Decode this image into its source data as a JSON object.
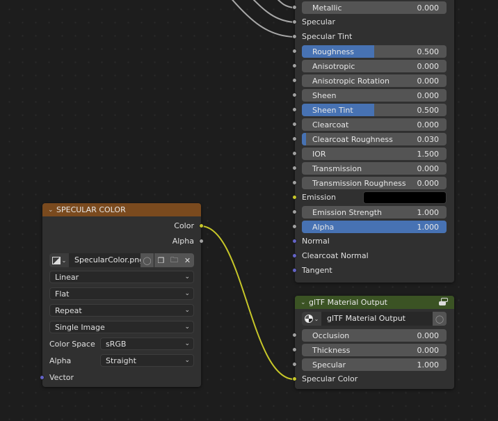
{
  "principled_node": {
    "inputs": [
      {
        "label": "Metallic",
        "value": "0.000",
        "fill": 0.0,
        "type": "slider"
      },
      {
        "label": "Specular",
        "type": "socket"
      },
      {
        "label": "Specular Tint",
        "type": "socket"
      },
      {
        "label": "Roughness",
        "value": "0.500",
        "fill": 0.5,
        "type": "slider"
      },
      {
        "label": "Anisotropic",
        "value": "0.000",
        "fill": 0.0,
        "type": "slider"
      },
      {
        "label": "Anisotropic Rotation",
        "value": "0.000",
        "fill": 0.0,
        "type": "slider"
      },
      {
        "label": "Sheen",
        "value": "0.000",
        "fill": 0.0,
        "type": "slider"
      },
      {
        "label": "Sheen Tint",
        "value": "0.500",
        "fill": 0.5,
        "type": "slider"
      },
      {
        "label": "Clearcoat",
        "value": "0.000",
        "fill": 0.0,
        "type": "slider"
      },
      {
        "label": "Clearcoat Roughness",
        "value": "0.030",
        "fill": 0.03,
        "type": "slider"
      },
      {
        "label": "IOR",
        "value": "1.500",
        "fill": 0.0,
        "type": "slider"
      },
      {
        "label": "Transmission",
        "value": "0.000",
        "fill": 0.0,
        "type": "slider"
      },
      {
        "label": "Transmission Roughness",
        "value": "0.000",
        "fill": 0.0,
        "type": "slider"
      },
      {
        "label": "Emission",
        "type": "color",
        "color": "#000000"
      },
      {
        "label": "Emission Strength",
        "value": "1.000",
        "fill": 0.0,
        "type": "slider"
      },
      {
        "label": "Alpha",
        "value": "1.000",
        "fill": 1.0,
        "type": "slider"
      },
      {
        "label": "Normal",
        "type": "vector"
      },
      {
        "label": "Clearcoat Normal",
        "type": "vector"
      },
      {
        "label": "Tangent",
        "type": "vector"
      }
    ]
  },
  "gltf_node": {
    "title": "glTF Material Output",
    "group_name": "glTF Material Output",
    "inputs": [
      {
        "label": "Occlusion",
        "value": "0.000"
      },
      {
        "label": "Thickness",
        "value": "0.000"
      },
      {
        "label": "Specular",
        "value": "1.000"
      }
    ],
    "color_input": "Specular Color"
  },
  "image_node": {
    "title": "SPECULAR COLOR",
    "outputs": {
      "color": "Color",
      "alpha": "Alpha"
    },
    "image_name": "SpecularColor.png",
    "interpolation": "Linear",
    "projection": "Flat",
    "extension": "Repeat",
    "source": "Single Image",
    "color_space_label": "Color Space",
    "color_space": "sRGB",
    "alpha_label": "Alpha",
    "alpha_mode": "Straight",
    "vector_input": "Vector"
  },
  "colors": {
    "image_header": "#7a4a1e",
    "group_header": "#3b5324",
    "slider_fill": "#4772b3",
    "color_socket": "#c7c729",
    "vector_socket": "#6363c7",
    "float_socket": "#a1a1a1"
  }
}
